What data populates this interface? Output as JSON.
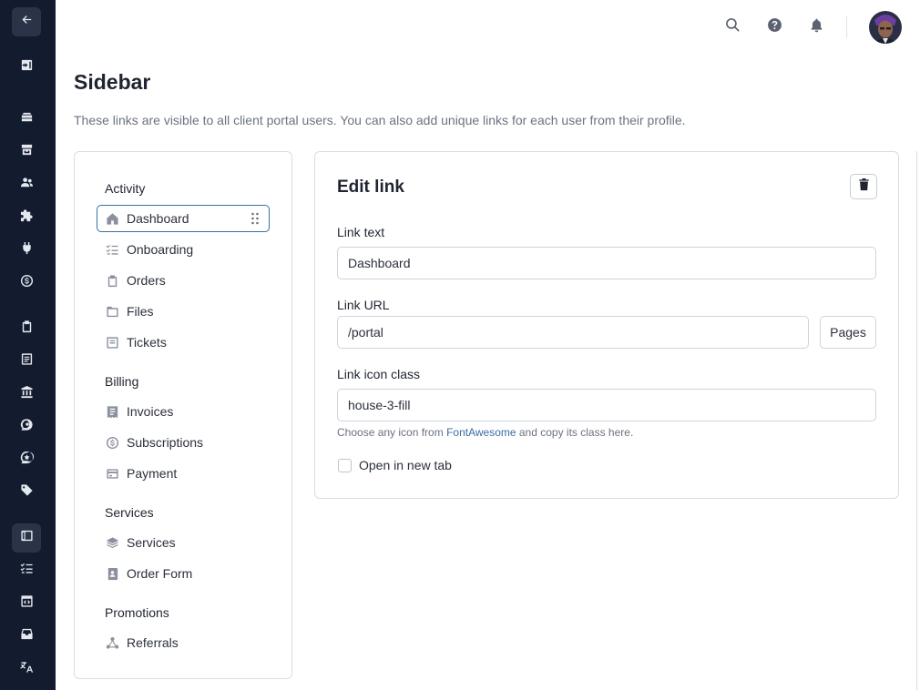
{
  "rail": {
    "items": [
      {
        "icon": "back-arrow-icon"
      },
      {
        "icon": "sign-in-icon"
      },
      {
        "icon": "inbox-stack-icon"
      },
      {
        "icon": "archive-icon"
      },
      {
        "icon": "users-icon"
      },
      {
        "icon": "puzzle-icon"
      },
      {
        "icon": "plug-icon"
      },
      {
        "icon": "dollar-circle-icon"
      },
      {
        "icon": "clipboard-icon"
      },
      {
        "icon": "receipt-icon"
      },
      {
        "icon": "bank-icon"
      },
      {
        "icon": "chat-search-icon"
      },
      {
        "icon": "star-badge-icon"
      },
      {
        "icon": "tag-icon"
      },
      {
        "icon": "sidebar-icon"
      },
      {
        "icon": "checklist-icon"
      },
      {
        "icon": "code-window-icon"
      },
      {
        "icon": "inbox-icon"
      },
      {
        "icon": "translate-icon"
      }
    ]
  },
  "topbar": {
    "icons": [
      "search-icon",
      "help-icon",
      "bell-icon"
    ]
  },
  "page": {
    "title": "Sidebar",
    "description": "These links are visible to all client portal users. You can also add unique links for each user from their profile."
  },
  "sidebar_links": {
    "sections": [
      {
        "label": "Activity",
        "items": [
          {
            "label": "Dashboard",
            "icon": "house-icon",
            "selected": true
          },
          {
            "label": "Onboarding",
            "icon": "checklist-icon"
          },
          {
            "label": "Orders",
            "icon": "clipboard-icon"
          },
          {
            "label": "Files",
            "icon": "folder-icon"
          },
          {
            "label": "Tickets",
            "icon": "ticket-icon"
          }
        ]
      },
      {
        "label": "Billing",
        "items": [
          {
            "label": "Invoices",
            "icon": "receipt-icon"
          },
          {
            "label": "Subscriptions",
            "icon": "dollar-circle-icon"
          },
          {
            "label": "Payment",
            "icon": "credit-card-icon"
          }
        ]
      },
      {
        "label": "Services",
        "items": [
          {
            "label": "Services",
            "icon": "stack-icon"
          },
          {
            "label": "Order Form",
            "icon": "contact-book-icon"
          }
        ]
      },
      {
        "label": "Promotions",
        "items": [
          {
            "label": "Referrals",
            "icon": "share-nodes-icon"
          }
        ]
      }
    ]
  },
  "edit": {
    "title": "Edit link",
    "link_text_label": "Link text",
    "link_text_value": "Dashboard",
    "link_url_label": "Link URL",
    "link_url_value": "/portal",
    "pages_button": "Pages",
    "icon_class_label": "Link icon class",
    "icon_class_value": "house-3-fill",
    "help_before": "Choose any icon from ",
    "help_link": "FontAwesome",
    "help_after": " and copy its class here.",
    "new_tab_label": "Open in new tab",
    "new_tab_checked": false
  }
}
